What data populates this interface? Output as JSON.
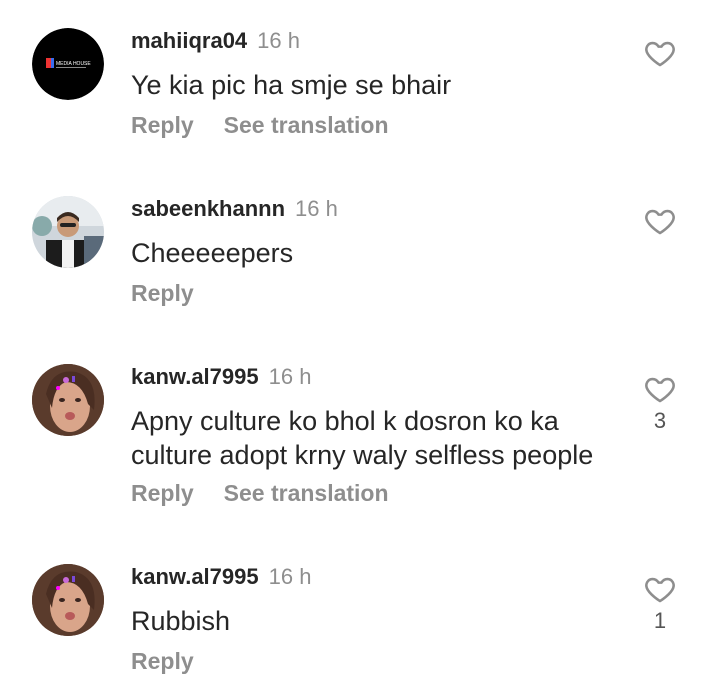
{
  "comments": [
    {
      "username": "mahiiqra04",
      "time": "16 h",
      "text": "Ye kia pic ha smje se bhair",
      "reply_label": "Reply",
      "translate_label": "See translation",
      "like_count": "",
      "avatar_text": "MEDIA HOUSE"
    },
    {
      "username": "sabeenkhannn",
      "time": "16 h",
      "text": "Cheeeeepers",
      "reply_label": "Reply",
      "translate_label": "",
      "like_count": ""
    },
    {
      "username": "kanw.al7995",
      "time": "16 h",
      "text": "Apny culture ko bhol k dosron ko ka\nculture adopt krny waly selfless people",
      "reply_label": "Reply",
      "translate_label": "See translation",
      "like_count": "3"
    },
    {
      "username": "kanw.al7995",
      "time": "16 h",
      "text": "Rubbish",
      "reply_label": "Reply",
      "translate_label": "",
      "like_count": "1"
    }
  ],
  "icons": {
    "like": "heart-outline-icon"
  },
  "colors": {
    "text": "#262626",
    "secondary": "#8e8e8e"
  }
}
